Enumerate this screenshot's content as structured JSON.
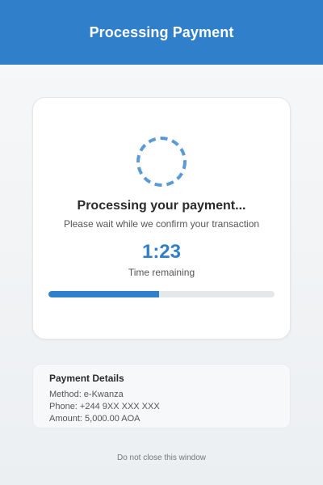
{
  "header": {
    "title": "Processing Payment"
  },
  "status": {
    "title": "Processing your payment...",
    "subtitle": "Please wait while we confirm your transaction",
    "timer": "1:23",
    "timer_label": "Time remaining",
    "progress": 0.49
  },
  "details": {
    "title": "Payment Details",
    "method": "Method: e-Kwanza",
    "phone": "Phone: +244 9XX XXX XXX",
    "amount": "Amount: 5,000.00 AOA"
  },
  "footer": {
    "note": "Do not close this window"
  },
  "colors": {
    "accent": "#2f7fcb",
    "track": "#e5e8eb",
    "spinner": "#5a9ad8"
  },
  "icons": {
    "spinner": "loading-spinner-icon"
  }
}
